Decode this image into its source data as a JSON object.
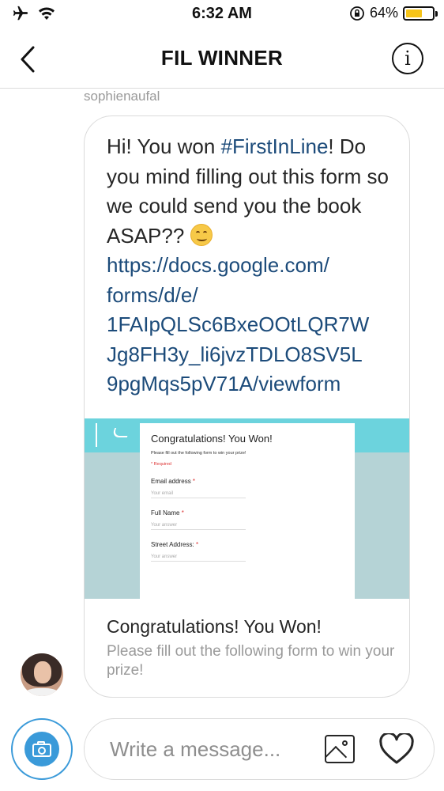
{
  "status_bar": {
    "time": "6:32 AM",
    "battery_percent": "64%",
    "battery_level": 0.64,
    "icons": [
      "airplane-icon",
      "wifi-icon",
      "orientation-lock-icon",
      "battery-icon"
    ]
  },
  "header": {
    "title": "FIL WINNER",
    "info_glyph": "i"
  },
  "message": {
    "sender": "sophienaufal",
    "text_before": "Hi! You won ",
    "hashtag": "#FirstInLine",
    "text_after": "! Do you mind filling out this form so we could send you the book ASAP?? ",
    "link": "https://docs.google.com/forms/d/e/1FAIpQLSc6BxeOOtLQR7WJg8FH3y_li6jvzTDLO8SV5L9pgMqs5pV71A/viewform",
    "link_display_lines": [
      "https://docs.google.com/",
      "forms/d/e/",
      "1FAIpQLSc6BxeOOtLQR7W",
      "Jg8FH3y_li6jvzTDLO8SV5L",
      "9pgMqs5pV71A/viewform"
    ]
  },
  "link_preview": {
    "form_title": "Congratulations! You Won!",
    "form_description": "Please fill out the following form to win your prize!",
    "required_note": "* Required",
    "fields": [
      {
        "label": "Email address",
        "placeholder": "Your email"
      },
      {
        "label": "Full Name",
        "placeholder": "Your answer"
      },
      {
        "label": "Street Address:",
        "placeholder": "Your answer"
      }
    ],
    "caption_title": "Congratulations! You Won!",
    "caption_description": "Please fill out the following form to win your prize!"
  },
  "composer": {
    "placeholder": "Write a message..."
  },
  "colors": {
    "link": "#1c4b7a",
    "camera_accent": "#3a9ad9",
    "battery": "#f6c419",
    "form_header": "#6cd3dd",
    "form_background": "#b5d3d6"
  }
}
